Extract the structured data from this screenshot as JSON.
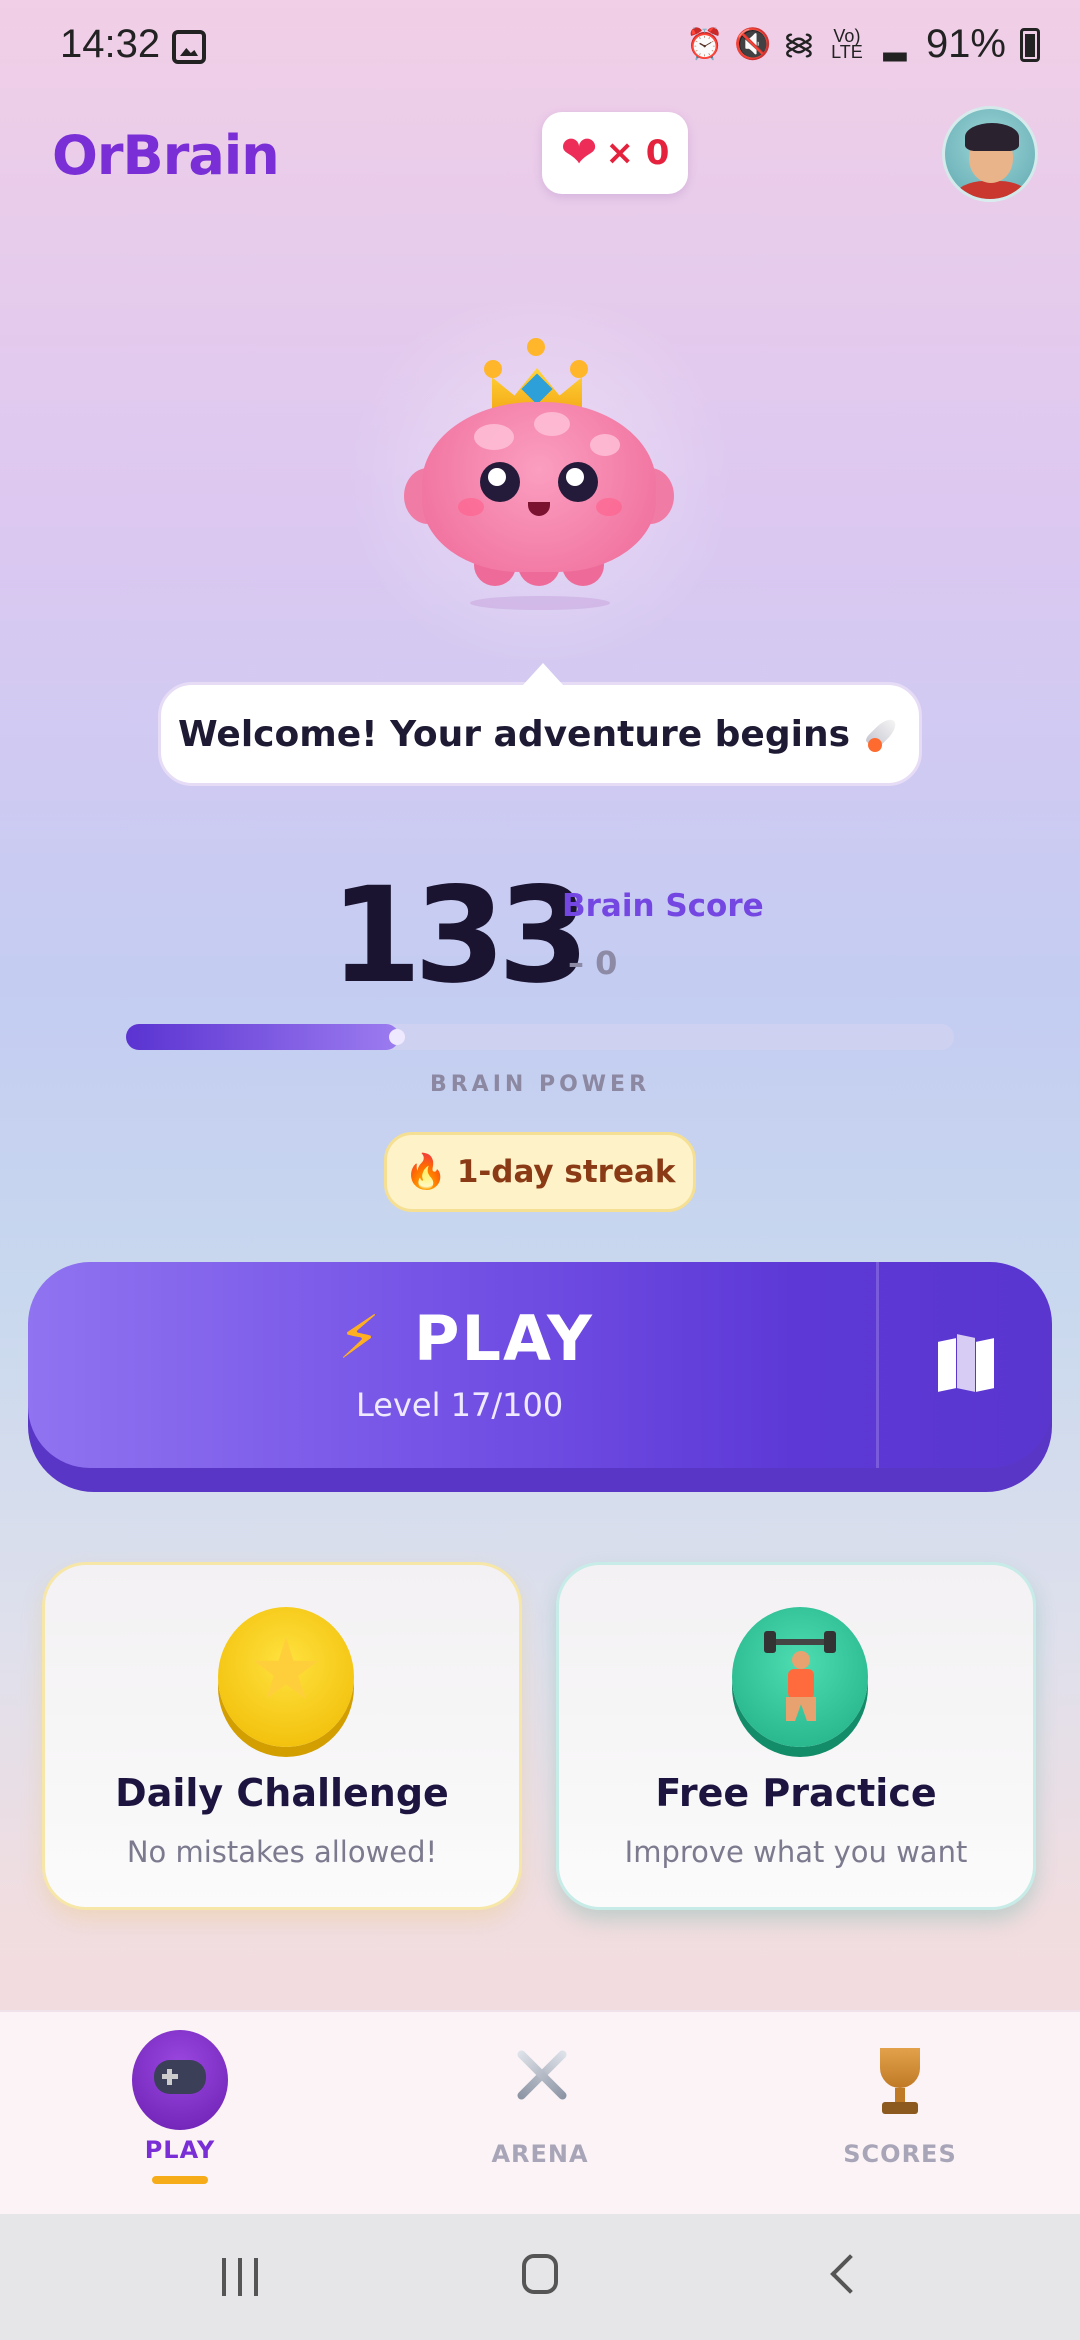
{
  "status_bar": {
    "time": "14:32",
    "battery": "91%",
    "icons": [
      "gallery-icon",
      "alarm-icon",
      "mute-icon",
      "wifi-icon",
      "volte-icon",
      "signal-icon",
      "battery-icon"
    ]
  },
  "header": {
    "app_name": "OrBrain",
    "lives_count": "× 0"
  },
  "mascot": {
    "message": "Welcome! Your adventure begins"
  },
  "score": {
    "value": "133",
    "label": "Brain Score",
    "delta": "– 0",
    "power_label": "BRAIN POWER",
    "power_fraction": 0.33
  },
  "streak": {
    "label": "1-day streak"
  },
  "play": {
    "label": "PLAY",
    "level": "Level 17/100"
  },
  "cards": [
    {
      "title": "Daily Challenge",
      "subtitle": "No mistakes allowed!"
    },
    {
      "title": "Free Practice",
      "subtitle": "Improve what you want"
    }
  ],
  "nav": {
    "items": [
      {
        "label": "PLAY",
        "icon": "gamepad-icon",
        "active": true
      },
      {
        "label": "ARENA",
        "icon": "swords-icon",
        "active": false
      },
      {
        "label": "SCORES",
        "icon": "trophy-icon",
        "active": false
      }
    ]
  },
  "colors": {
    "brand": "#7a2fd6",
    "play_button": "#7553e6",
    "streak_bg": "#fdf2c8",
    "heart": "#ee2c58"
  }
}
